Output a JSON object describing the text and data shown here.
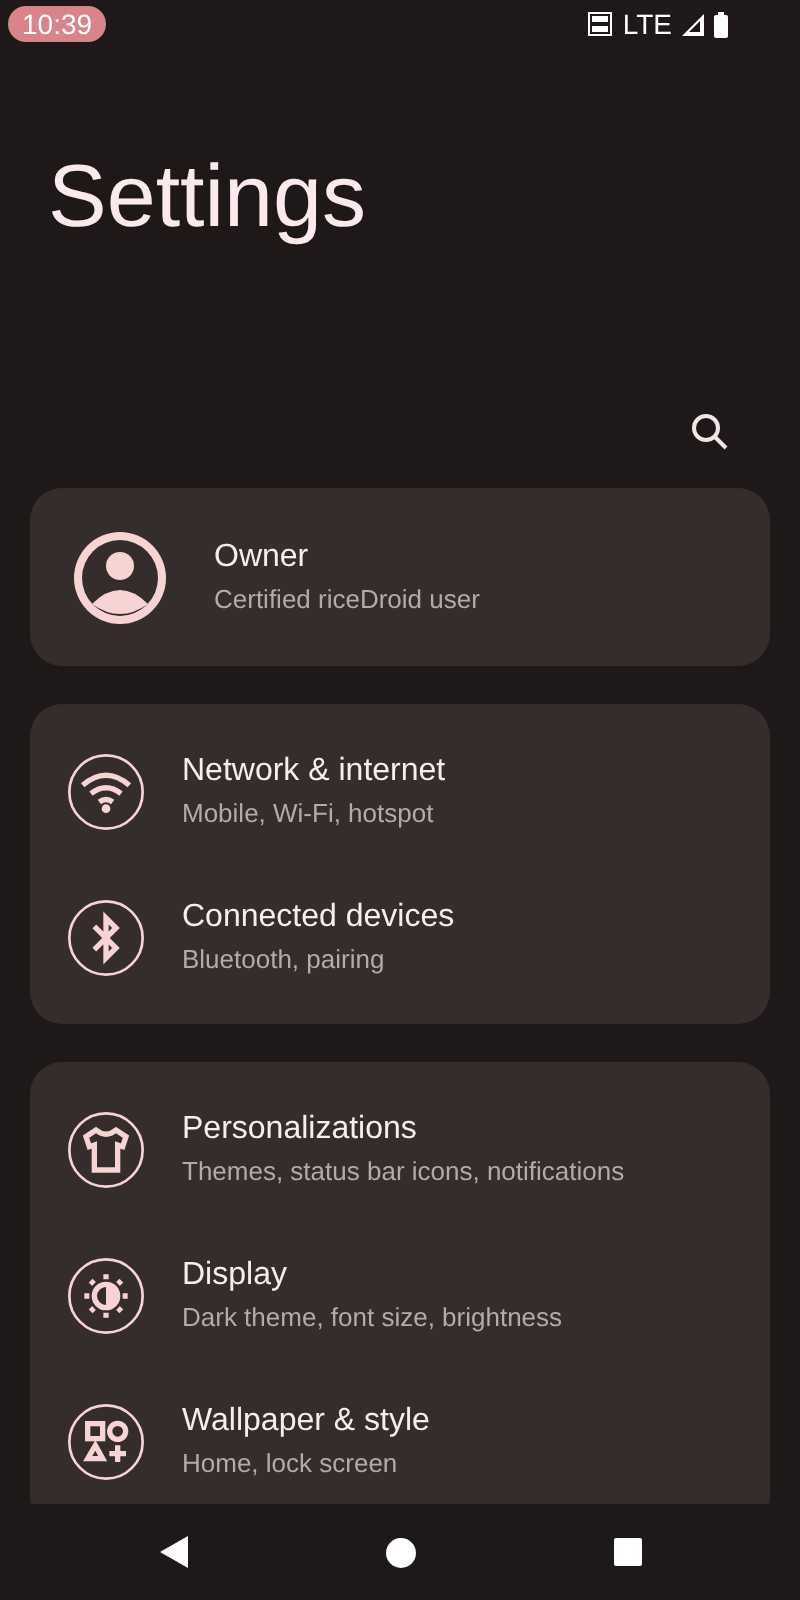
{
  "status_bar": {
    "time": "10:39",
    "network": "LTE"
  },
  "title": "Settings",
  "profile": {
    "name": "Owner",
    "subtitle": "Certified riceDroid user"
  },
  "groups": [
    {
      "items": [
        {
          "title": "Network & internet",
          "subtitle": "Mobile, Wi-Fi, hotspot"
        },
        {
          "title": "Connected devices",
          "subtitle": "Bluetooth, pairing"
        }
      ]
    },
    {
      "items": [
        {
          "title": "Personalizations",
          "subtitle": "Themes, status bar icons, notifications"
        },
        {
          "title": "Display",
          "subtitle": "Dark theme, font size, brightness"
        },
        {
          "title": "Wallpaper & style",
          "subtitle": "Home, lock screen"
        }
      ]
    }
  ]
}
